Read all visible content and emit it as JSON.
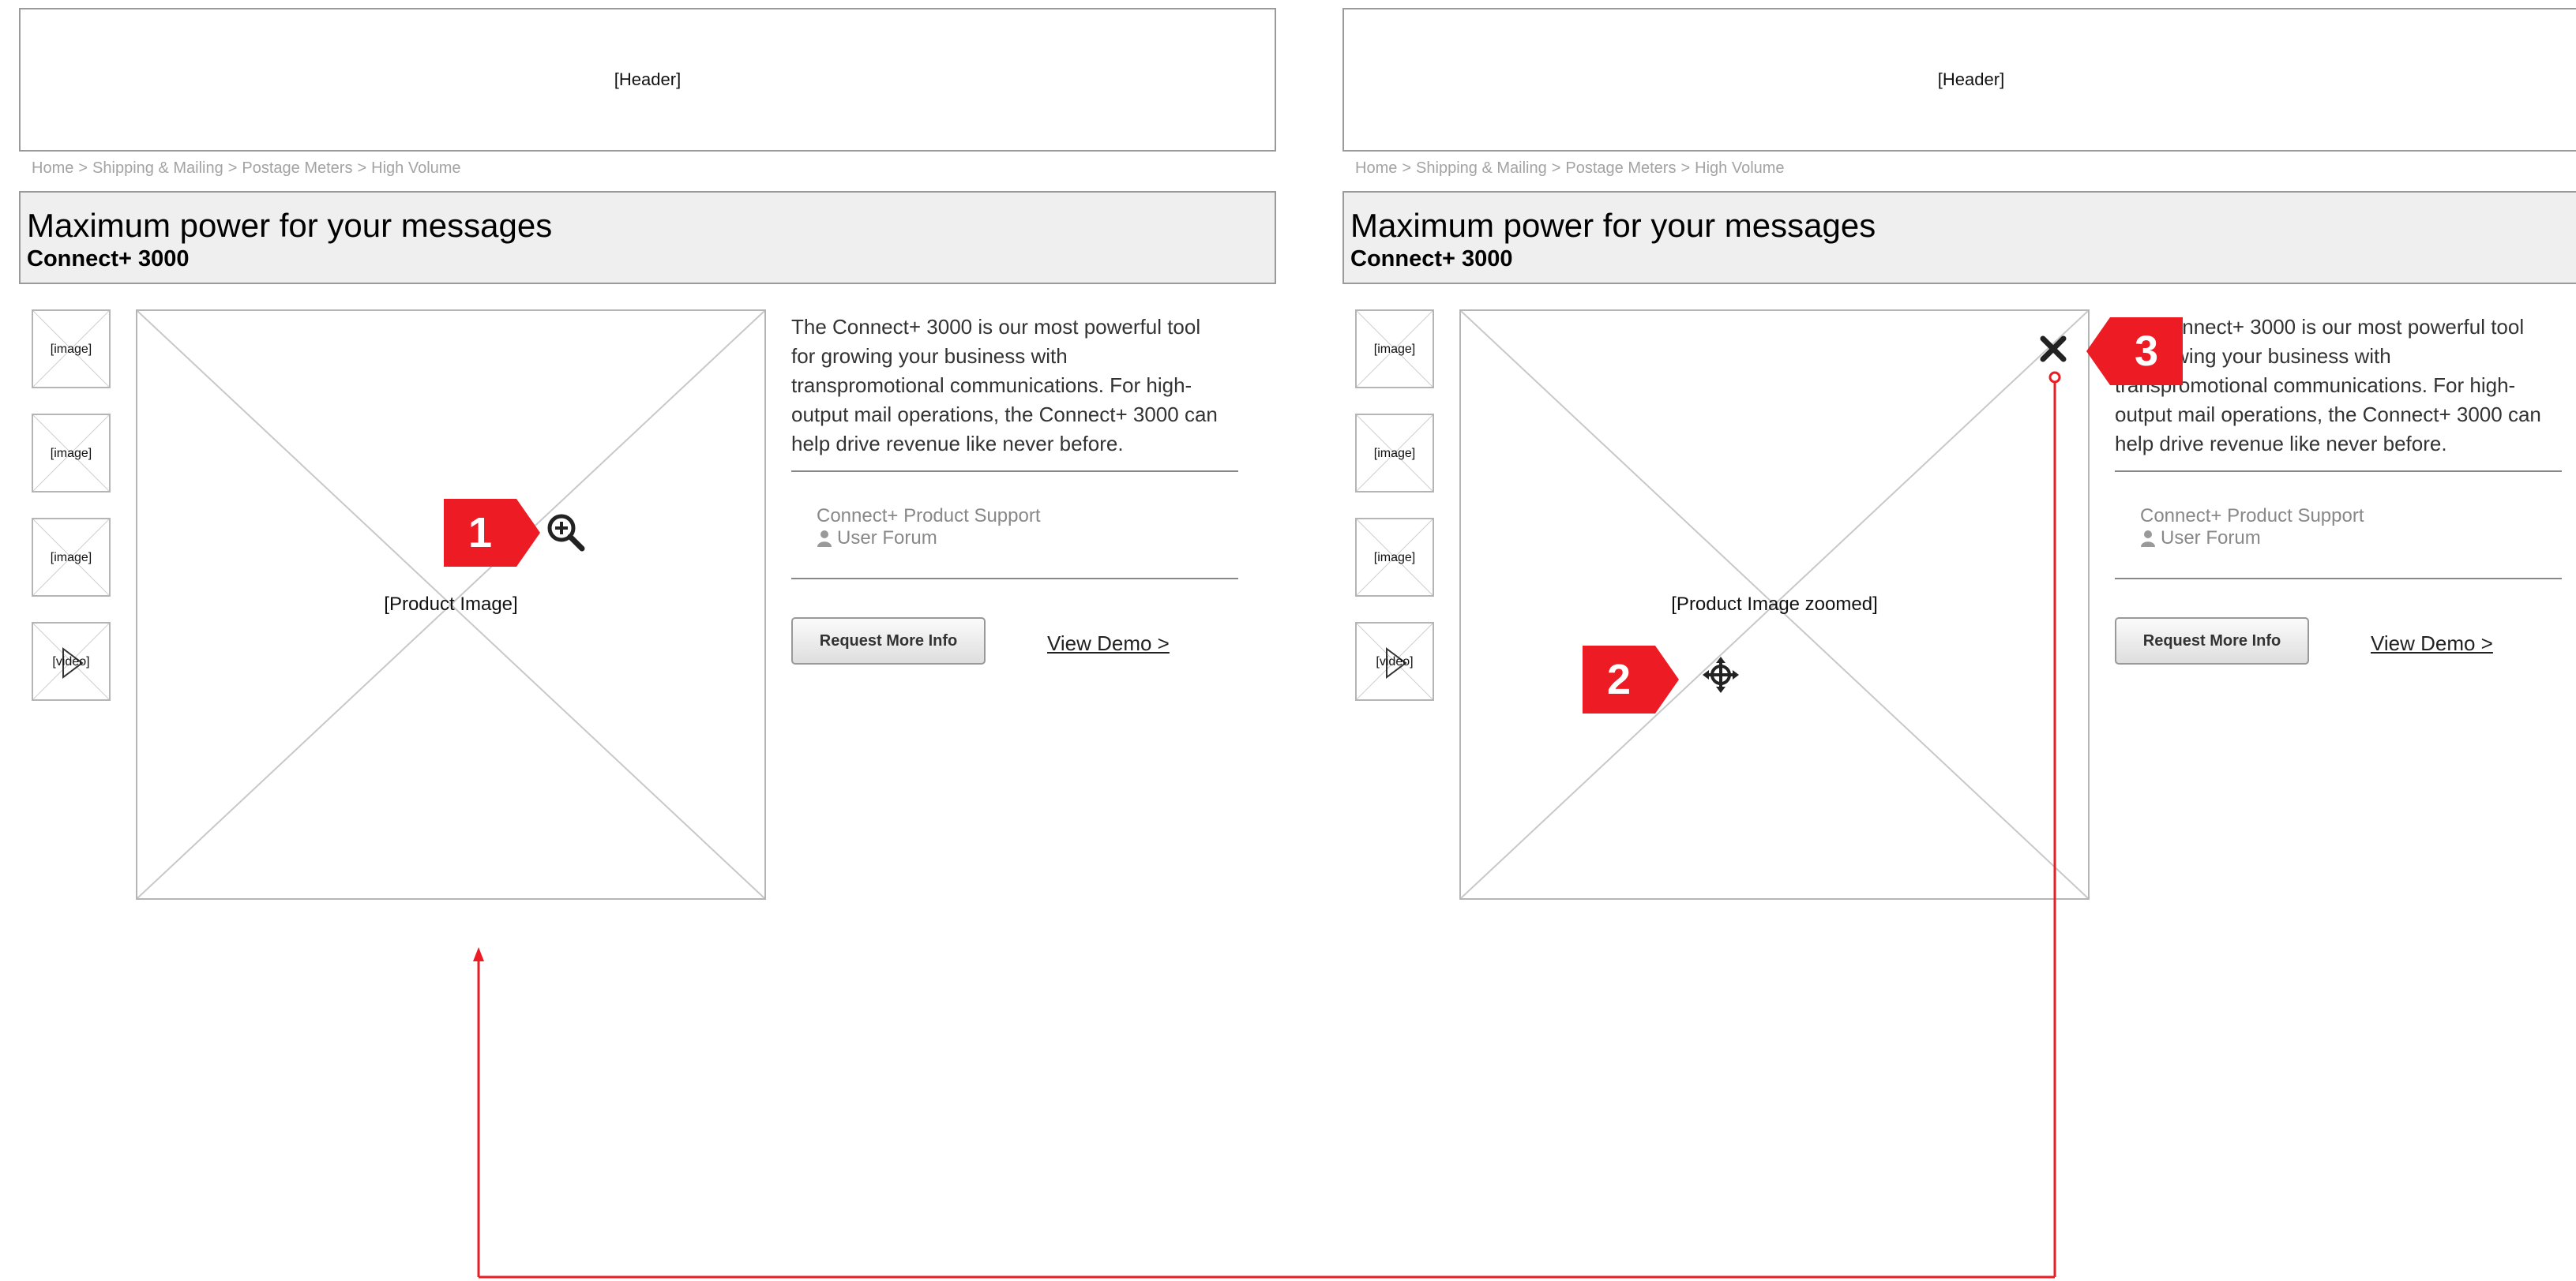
{
  "colors": {
    "annotation_red": "#ED1C24",
    "border_gray": "#9A9A9A",
    "title_bg": "#EFEFEF",
    "muted_text": "#888888"
  },
  "left": {
    "header_placeholder": "[Header]",
    "breadcrumb": [
      "Home",
      "Shipping & Mailing",
      "Postage Meters",
      "High Volume"
    ],
    "breadcrumb_separator": ">",
    "title": "Maximum power for your messages",
    "subtitle": "Connect+ 3000",
    "thumbnails": [
      "[image]",
      "[image]",
      "[image]",
      "[video]"
    ],
    "main_image_label": "[Product Image]",
    "description": "The Connect+ 3000 is our most powerful tool for growing your business with transpromotional communications. For high-output mail operations, the Connect+ 3000 can help drive revenue like never before.",
    "support_link": "Connect+ Product Support",
    "forum_link": "User Forum",
    "request_button": "Request More Info",
    "demo_link": "View Demo >",
    "marker": "1",
    "icon": "zoom-in-icon"
  },
  "right": {
    "header_placeholder": "[Header]",
    "breadcrumb": [
      "Home",
      "Shipping & Mailing",
      "Postage Meters",
      "High Volume"
    ],
    "breadcrumb_separator": ">",
    "title": "Maximum power for your messages",
    "subtitle": "Connect+ 3000",
    "thumbnails": [
      "[image]",
      "[image]",
      "[image]",
      "[video]"
    ],
    "main_image_label": "[Product Image zoomed]",
    "description": "The Connect+ 3000 is our most powerful tool for growing your business with transpromotional communications. For high-output mail operations, the Connect+ 3000 can help drive revenue like never before.",
    "support_link": "Connect+ Product Support",
    "forum_link": "User Forum",
    "request_button": "Request More Info",
    "demo_link": "View Demo >",
    "marker_pan": "2",
    "marker_close": "3",
    "pan_icon": "move-icon",
    "close_icon": "close-icon"
  }
}
